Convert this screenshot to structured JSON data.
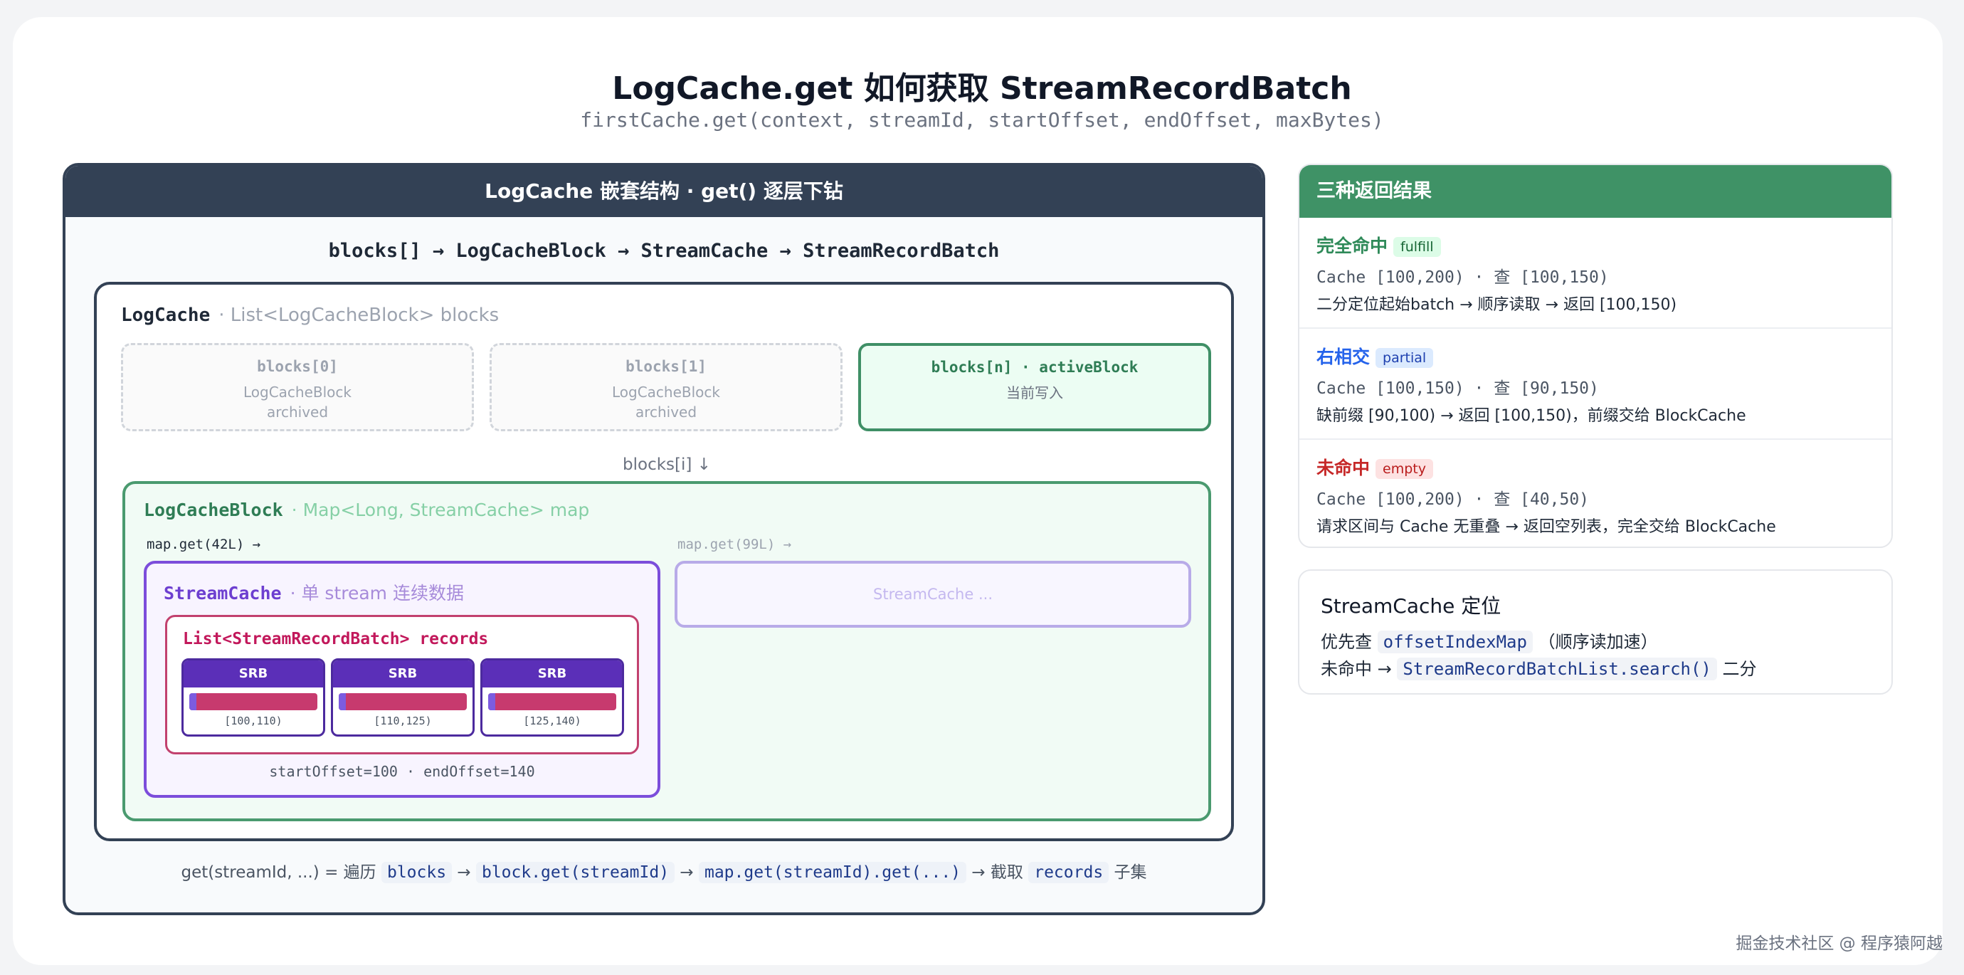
{
  "title": "LogCache.get 如何获取 StreamRecordBatch",
  "subtitle": "firstCache.get(context, streamId, startOffset, endOffset, maxBytes)",
  "diagram": {
    "header": "LogCache 嵌套结构 · get() 逐层下钻",
    "chain": "blocks[] → LogCacheBlock → StreamCache → StreamRecordBatch",
    "logcache": {
      "name": "LogCache",
      "sub": "· List<LogCacheBlock> blocks",
      "blocks": [
        {
          "name": "blocks[0]",
          "type": "LogCacheBlock",
          "status": "archived"
        },
        {
          "name": "blocks[1]",
          "type": "LogCacheBlock",
          "status": "archived"
        },
        {
          "name": "blocks[n] · activeBlock",
          "status": "当前写入"
        }
      ],
      "drill_label": "blocks[i] ↓"
    },
    "logcacheblock": {
      "name": "LogCacheBlock",
      "sub": "· Map<Long, StreamCache> map",
      "mapget1": "map.get(42L) →",
      "mapget2": "map.get(99L) →",
      "other_streamcache": "StreamCache ..."
    },
    "streamcache": {
      "name": "StreamCache",
      "sub": "· 单 stream 连续数据",
      "records_label": "List<StreamRecordBatch> records",
      "srbs": [
        {
          "label": "SRB",
          "range": "[100,110)"
        },
        {
          "label": "SRB",
          "range": "[110,125)"
        },
        {
          "label": "SRB",
          "range": "[125,140)"
        }
      ],
      "offsets": "startOffset=100 · endOffset=140"
    },
    "footer": {
      "pre": "get(streamId, ...) = 遍历",
      "code1": "blocks",
      "arrow1": "→",
      "code2": "block.get(streamId)",
      "arrow2": "→",
      "code3": "map.get(streamId).get(...)",
      "mid": "→ 截取",
      "code4": "records",
      "post": "子集"
    }
  },
  "results": {
    "header": "三种返回结果",
    "items": [
      {
        "title": "完全命中",
        "badge": "fulfill",
        "cache": "Cache [100,200) · 查 [100,150)",
        "desc": "二分定位起始batch → 顺序读取 → 返回 [100,150)"
      },
      {
        "title": "右相交",
        "badge": "partial",
        "cache": "Cache [100,150) · 查 [90,150)",
        "desc": "缺前缀 [90,100) → 返回 [100,150)，前缀交给 BlockCache"
      },
      {
        "title": "未命中",
        "badge": "empty",
        "cache": "Cache [100,200) · 查 [40,50)",
        "desc": "请求区间与 Cache 无重叠 → 返回空列表，完全交给 BlockCache"
      }
    ],
    "colors": [
      "#2f8a59",
      "#2563eb",
      "#c62828"
    ],
    "badge_bg": [
      "#dcfce7",
      "#dbeafe",
      "#fde2e2"
    ],
    "badge_fg": [
      "#166534",
      "#1e40af",
      "#b91c1c"
    ]
  },
  "locate": {
    "title": "StreamCache 定位",
    "l1_pre": "优先查",
    "l1_code": "offsetIndexMap",
    "l1_post": "（顺序读加速）",
    "l2_pre": "未命中 →",
    "l2_code": "StreamRecordBatchList.search()",
    "l2_post": "二分"
  },
  "watermark": "掘金技术社区 @ 程序猿阿越"
}
